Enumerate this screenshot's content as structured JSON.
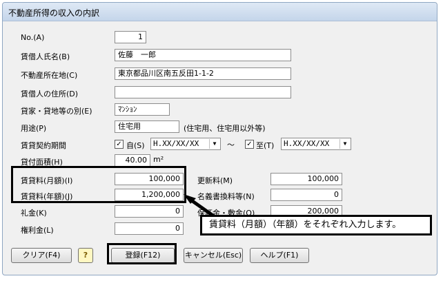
{
  "window": {
    "title": "不動産所得の収入の内訳"
  },
  "labels": {
    "no": "No.(A)",
    "tenant_name": "賃借人氏名(B)",
    "property_location": "不動産所在地(C)",
    "tenant_address": "賃借人の住所(D)",
    "type": "貸家・貸地等の別(E)",
    "usage": "用途(P)",
    "usage_hint": "(住宅用、住宅用以外等)",
    "contract_period": "賃貸契約期間",
    "from_label": "自(S)",
    "tilde": "～",
    "to_label": "至(T)",
    "area": "貸付面積(H)",
    "area_unit": "m²",
    "rent_month": "賃貸料(月額)(I)",
    "rent_year": "賃貸料(年額)(J)",
    "renewal_fee": "更新料(M)",
    "transfer_fee": "名義書換料等(N)",
    "key_money": "礼金(K)",
    "deposit": "保証金・敷金(O)",
    "premium": "権利金(L)"
  },
  "values": {
    "no": "1",
    "tenant_name": "佐藤　一郎",
    "property_location": "東京都品川区南五反田1-1-2",
    "tenant_address": "",
    "type": "ﾏﾝｼｮﾝ",
    "usage": "住宅用",
    "from_date": "H.XX/XX/XX",
    "to_date": "H.XX/XX/XX",
    "from_checked": "✓",
    "to_checked": "✓",
    "area": "40.00",
    "rent_month": "100,000",
    "rent_year": "1,200,000",
    "renewal_fee": "100,000",
    "transfer_fee": "0",
    "key_money": "0",
    "deposit": "200,000",
    "premium": "0"
  },
  "buttons": {
    "clear": "クリア(F4)",
    "hint_icon": "?",
    "register": "登録(F12)",
    "cancel": "キャンセル(Esc)",
    "help": "ヘルプ(F1)"
  },
  "callout": "賃貸料（月額）（年額）をそれぞれ入力します。",
  "icons": {
    "dropdown": "▼",
    "hint": "lightbulb-question-icon"
  }
}
